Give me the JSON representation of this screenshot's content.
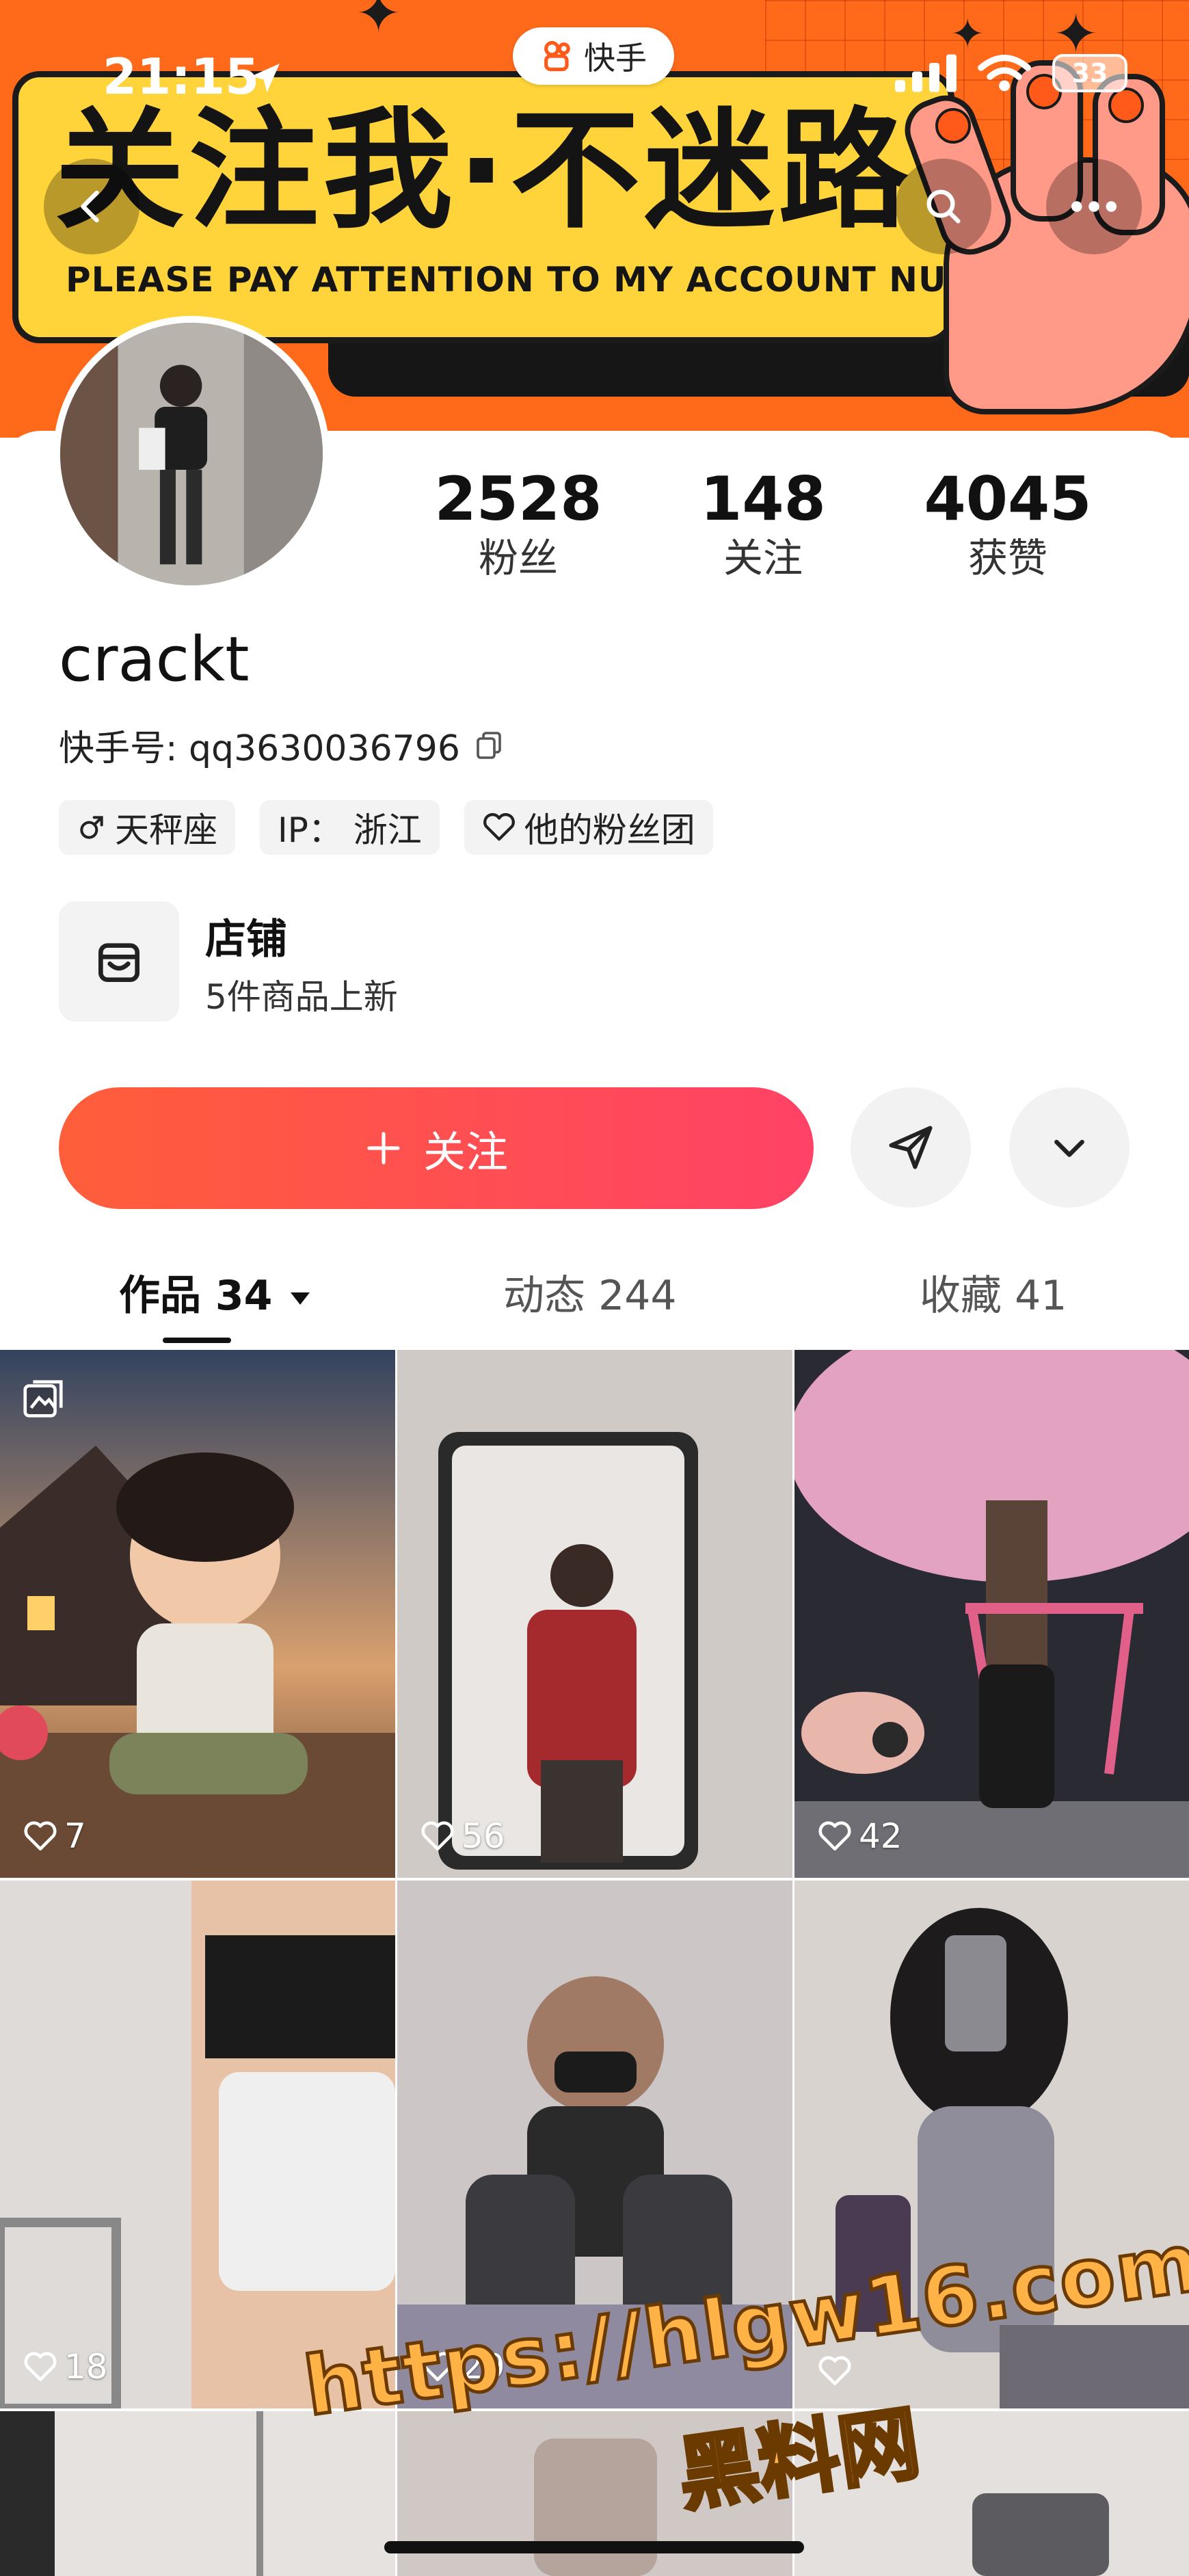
{
  "status_bar": {
    "time": "21:15",
    "battery": "33"
  },
  "app_badge": {
    "label": "快手"
  },
  "banner": {
    "headline": "关注我·不迷路",
    "subtitle": "PLEASE PAY ATTENTION TO MY ACCOUNT NUMBER"
  },
  "profile": {
    "username": "crackt",
    "account_id": "快手号: qq3630036796",
    "stats": [
      {
        "value": "2528",
        "label": "粉丝"
      },
      {
        "value": "148",
        "label": "关注"
      },
      {
        "value": "4045",
        "label": "获赞"
      }
    ],
    "tags": {
      "zodiac": "天秤座",
      "ip": "IP： 浙江",
      "fan_group": "他的粉丝团"
    }
  },
  "shop": {
    "title": "店铺",
    "subtitle": "5件商品上新"
  },
  "actions": {
    "follow_label": "关注",
    "follow_icon": "plus-icon",
    "share_icon": "send-icon",
    "more_icon": "chevron-down-icon"
  },
  "tabs": [
    {
      "label": "作品 34"
    },
    {
      "label": "动态 244"
    },
    {
      "label": "收藏 41"
    }
  ],
  "posts": [
    {
      "likes": "7",
      "palette": [
        "#3d4f6e",
        "#c98a5a"
      ]
    },
    {
      "likes": "56",
      "palette": [
        "#c7c4c2",
        "#8a2a2a"
      ]
    },
    {
      "likes": "42",
      "palette": [
        "#d88fb0",
        "#2c2c33"
      ]
    },
    {
      "likes": "18",
      "palette": [
        "#d9d6d3",
        "#2a2a2a"
      ]
    },
    {
      "likes": "29",
      "palette": [
        "#c9c4c6",
        "#3a3a3a"
      ]
    },
    {
      "likes": "",
      "palette": [
        "#d7d1cf",
        "#707080"
      ]
    }
  ],
  "watermark": {
    "line1": "https://hlgw16.com",
    "line2": "黑料网"
  },
  "colors": {
    "accent": "#ff4d4f",
    "banner_orange": "#ff6a1a",
    "banner_yellow": "#ffd43a"
  }
}
